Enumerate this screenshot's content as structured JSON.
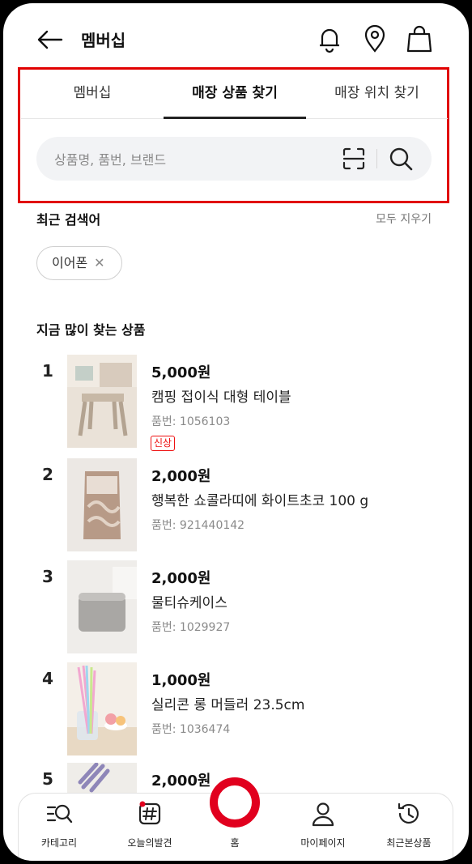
{
  "header": {
    "title": "멤버십"
  },
  "tabs": [
    {
      "label": "멤버십",
      "active": false
    },
    {
      "label": "매장 상품 찾기",
      "active": true
    },
    {
      "label": "매장 위치 찾기",
      "active": false
    }
  ],
  "search": {
    "placeholder": "상품명, 품번, 브랜드"
  },
  "recent": {
    "title": "최근 검색어",
    "clear_all": "모두 지우기",
    "chips": [
      {
        "label": "이어폰"
      }
    ]
  },
  "popular": {
    "title": "지금 많이 찾는 상품",
    "items": [
      {
        "rank": "1",
        "price": "5,000원",
        "name": "캠핑 접이식 대형 테이블",
        "code": "품번: 1056103",
        "badge": "신상"
      },
      {
        "rank": "2",
        "price": "2,000원",
        "name": "행복한 쇼콜라띠에 화이트초코 100 g",
        "code": "품번: 921440142"
      },
      {
        "rank": "3",
        "price": "2,000원",
        "name": "물티슈케이스",
        "code": "품번: 1029927"
      },
      {
        "rank": "4",
        "price": "1,000원",
        "name": "실리콘 롱 머들러 23.5cm",
        "code": "품번: 1036474"
      },
      {
        "rank": "5",
        "price": "2,000원"
      }
    ]
  },
  "bottom_nav": {
    "category": "카테고리",
    "today": "오늘의발견",
    "home": "홈",
    "mypage": "마이페이지",
    "recent_viewed": "최근본상품"
  },
  "colors": {
    "accent_red": "#e1001e",
    "highlight_box": "#e10000",
    "new_badge": "#ee1111"
  }
}
